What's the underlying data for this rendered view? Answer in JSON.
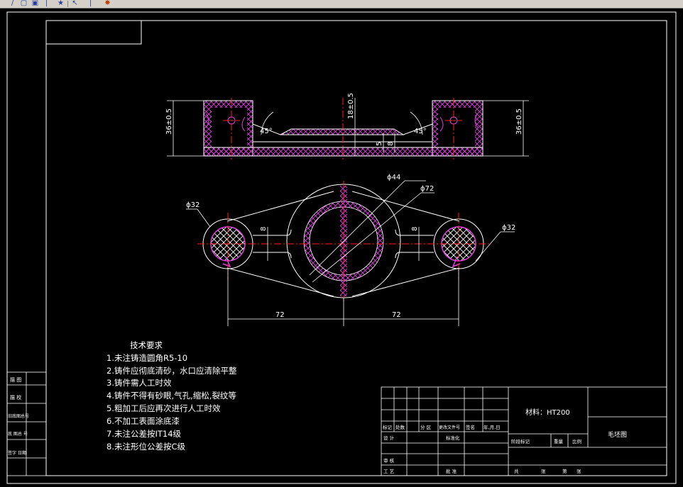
{
  "toolbar": {
    "buttons": [
      {
        "icon": "pencil-icon",
        "glyph": "/"
      },
      {
        "icon": "new-file-icon",
        "glyph": "▢"
      },
      {
        "icon": "save-icon",
        "glyph": "▣"
      },
      {
        "icon": "star-icon",
        "glyph": "★"
      },
      {
        "icon": "pipe-icon",
        "glyph": "|"
      },
      {
        "icon": "arrow-icon",
        "glyph": "↖"
      },
      {
        "icon": "render-icon",
        "glyph": "✸"
      }
    ]
  },
  "colors": {
    "background": "#000000",
    "lines": "#ffffff",
    "section_hatch": "#e040e0",
    "centerline": "#ff2020",
    "dimension": "#ffffff"
  },
  "drawing": {
    "top_view": {
      "dims": {
        "left_height": "36±0.5",
        "right_height": "36±0.5",
        "center_height": "18±0.5",
        "angle_left": "45°",
        "angle_right": "45°",
        "thick_5": "5",
        "thick_8": "8"
      }
    },
    "plan_view": {
      "dims": {
        "phi44": "ϕ44",
        "phi72": "ϕ72",
        "phi32_left": "ϕ32",
        "phi32_right": "ϕ32",
        "rib_left": "8",
        "rib_right": "8",
        "len_left": "72",
        "len_right": "72"
      }
    }
  },
  "tech_requirements": {
    "title": "技术要求",
    "items": [
      "1.未注铸造圆角R5-10",
      "2.铸件应彻底清砂，水口应清除平整",
      "3.铸件需人工时效",
      "4.铸件不得有砂眼,气孔,缩松,裂纹等",
      "5.粗加工后应再次进行人工时效",
      "6.不加工表面涂底漆",
      "7.未注公差按IT14级",
      "8.未注形位公差按C级"
    ]
  },
  "left_strip": {
    "labels": [
      "描 图",
      "描 校",
      "旧底图总号",
      "底 图总 号",
      "签字 日期"
    ]
  },
  "title_block": {
    "material": "材料：HT200",
    "part_name": "毛坯图",
    "row_headers": [
      "标记",
      "处数",
      "分 区",
      "更改文件号",
      "签名",
      "年,月,日"
    ],
    "design": "设 计",
    "standardize": "标准化",
    "review": "审 核",
    "process": "工 艺",
    "approve": "批 准",
    "stage_mark": "阶段标记",
    "weight": "重量",
    "scale": "比例",
    "sheets_total": "共",
    "sheet_word": "张",
    "page": "第",
    "page_sheet": "张"
  }
}
